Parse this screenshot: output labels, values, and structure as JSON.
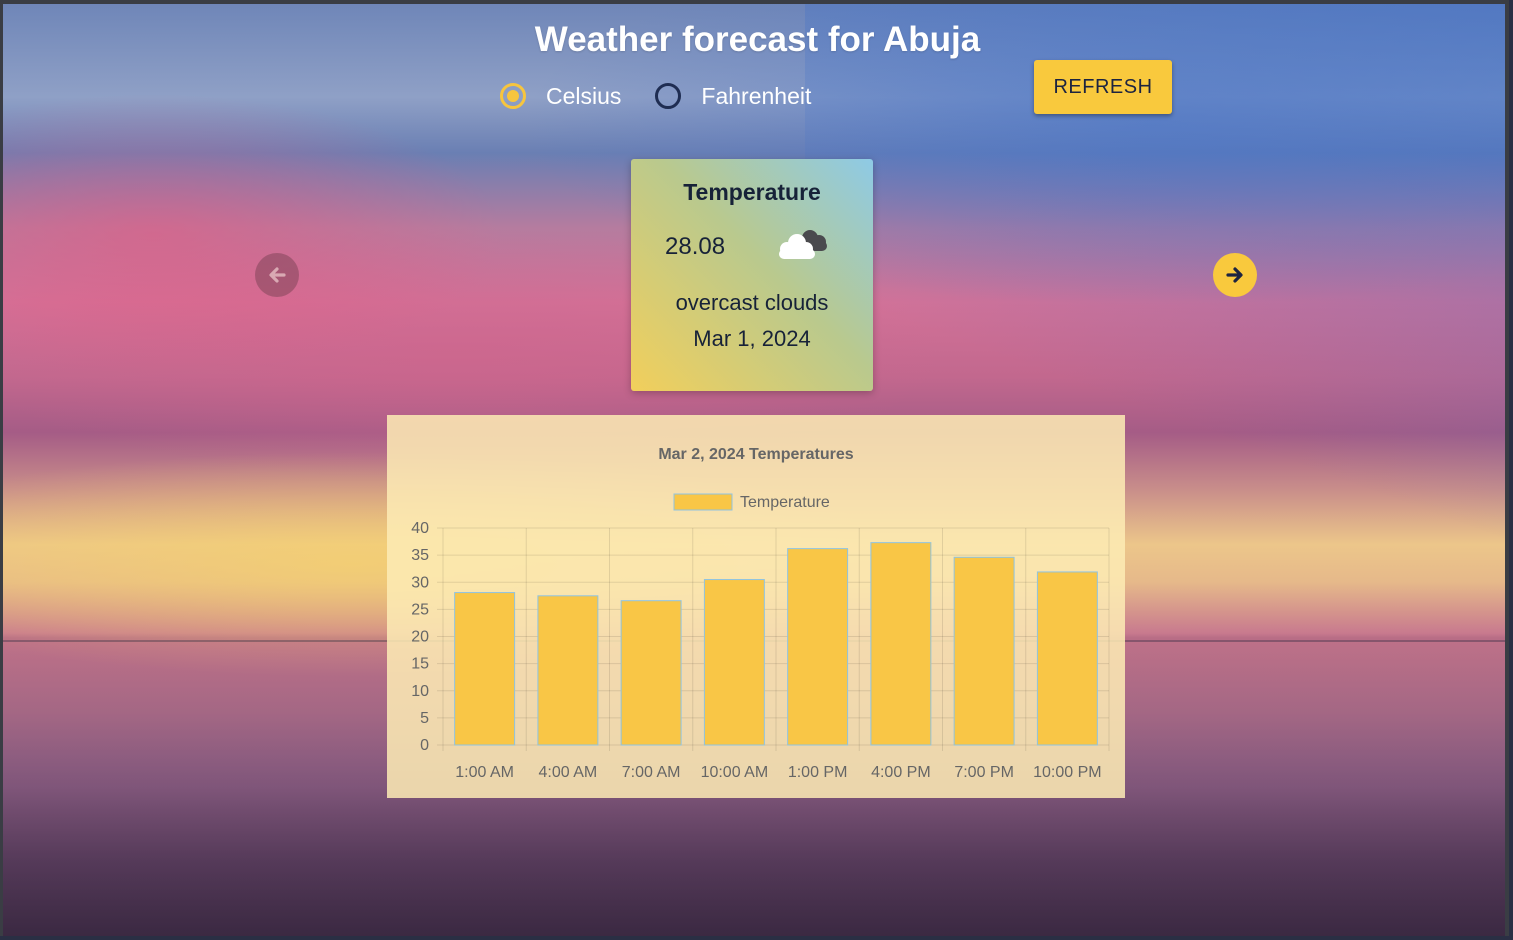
{
  "page": {
    "title": "Weather forecast for Abuja"
  },
  "units": {
    "options": [
      {
        "label": "Celsius",
        "checked": true
      },
      {
        "label": "Fahrenheit",
        "checked": false
      }
    ]
  },
  "toolbar": {
    "refresh_label": "REFRESH"
  },
  "card": {
    "heading": "Temperature",
    "value": "28.08",
    "icon": "broken-clouds-icon",
    "description": "overcast clouds",
    "date": "Mar 1, 2024"
  },
  "colors": {
    "accent": "#f9c93d",
    "text_dark": "#172238",
    "bar_fill": "#f9c646",
    "bar_border": "#8fc3e0"
  },
  "chart_data": {
    "type": "bar",
    "title": "Mar 2, 2024 Temperatures",
    "categories": [
      "1:00 AM",
      "4:00 AM",
      "7:00 AM",
      "10:00 AM",
      "1:00 PM",
      "4:00 PM",
      "7:00 PM",
      "10:00 PM"
    ],
    "series": [
      {
        "name": "Temperature",
        "values": [
          28.1,
          27.5,
          26.6,
          30.5,
          36.2,
          37.3,
          34.6,
          31.9
        ]
      }
    ],
    "yticks": [
      "0",
      "5",
      "10",
      "15",
      "20",
      "25",
      "30",
      "35",
      "40"
    ],
    "ylim": [
      0,
      40
    ],
    "legend_position": "top",
    "grid": true
  }
}
